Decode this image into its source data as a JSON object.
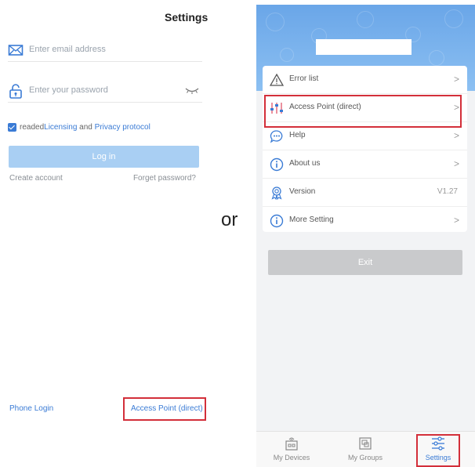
{
  "login": {
    "title": "Settings",
    "email_placeholder": "Enter email address",
    "password_placeholder": "Enter your password",
    "agree_prefix": "readed ",
    "licensing_link": "Licensing",
    "agree_and": " and ",
    "privacy_link": "Privacy protocol",
    "login_button": "Log in",
    "create_account": "Create account",
    "forget_password": "Forget password?",
    "phone_login": "Phone Login",
    "access_point_link": "Access Point (direct)"
  },
  "separator": "or",
  "settings": {
    "menu": [
      {
        "label": "Error list",
        "icon": "warning-icon",
        "chevron": ">"
      },
      {
        "label": "Access Point (direct)",
        "icon": "sliders-icon",
        "chevron": ">"
      },
      {
        "label": "Help",
        "icon": "chat-bubble-icon",
        "chevron": ">"
      },
      {
        "label": "About us",
        "icon": "info-icon",
        "chevron": ">"
      },
      {
        "label": "Version",
        "icon": "badge-icon",
        "value": "V1.27"
      },
      {
        "label": "More Setting",
        "icon": "info-icon",
        "chevron": ">"
      }
    ],
    "exit_button": "Exit",
    "tabs": [
      {
        "label": "My Devices",
        "icon": "device-icon"
      },
      {
        "label": "My Groups",
        "icon": "groups-icon"
      },
      {
        "label": "Settings",
        "icon": "settings-sliders-icon",
        "active": true
      }
    ],
    "colors": {
      "accent": "#3a7bd5",
      "highlight": "#d32f3a",
      "header": "#7ab2ee"
    }
  }
}
